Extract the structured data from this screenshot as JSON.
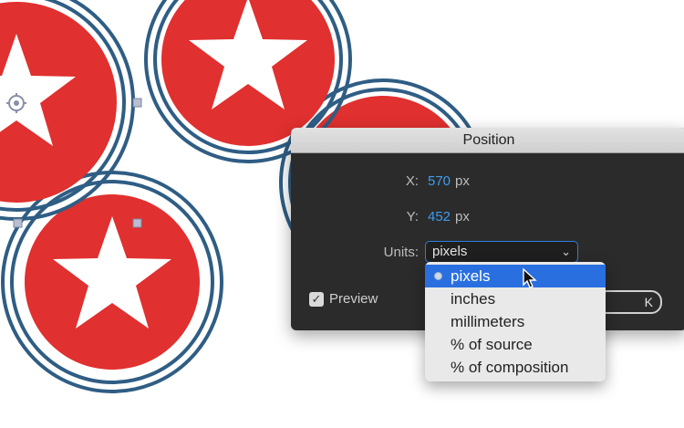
{
  "dialog": {
    "title": "Position",
    "x_label": "X:",
    "x_value": "570",
    "x_unit": "px",
    "y_label": "Y:",
    "y_value": "452",
    "y_unit": "px",
    "units_label": "Units:",
    "units_selected": "pixels",
    "preview_label": "Preview",
    "preview_checked": true
  },
  "units_menu": {
    "options": [
      "pixels",
      "inches",
      "millimeters",
      "% of source",
      "% of composition"
    ],
    "selected_index": 0
  },
  "colors": {
    "circle_fill": "#e0302f",
    "ring_stroke": "#2f5d84",
    "dialog_bg": "#2b2b2b",
    "value_blue": "#3d9cf0",
    "menu_highlight": "#2a6fe0"
  },
  "icons": [
    "star-icon",
    "anchor-point-icon",
    "chevron-down-icon",
    "checkmark-icon",
    "radio-dot-icon",
    "mouse-pointer-icon"
  ]
}
